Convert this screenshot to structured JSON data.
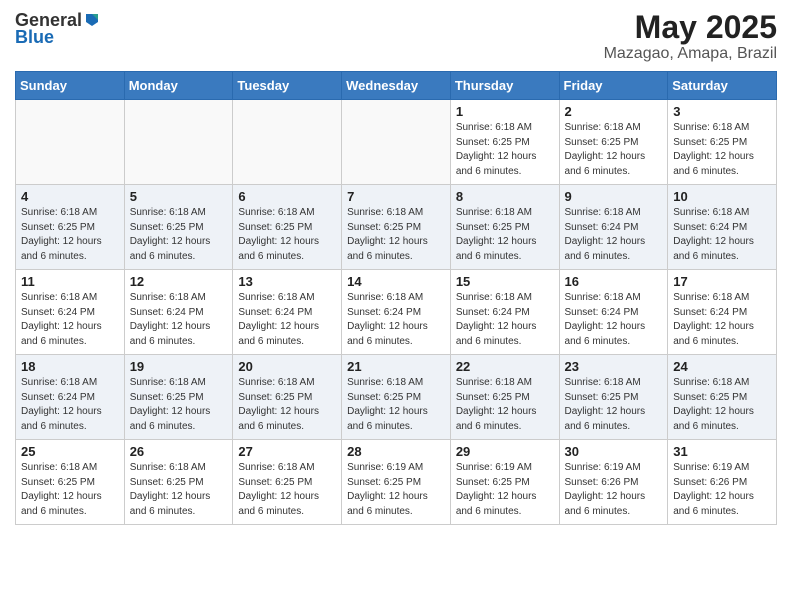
{
  "logo": {
    "general": "General",
    "blue": "Blue"
  },
  "title": "May 2025",
  "subtitle": "Mazagao, Amapa, Brazil",
  "weekdays": [
    "Sunday",
    "Monday",
    "Tuesday",
    "Wednesday",
    "Thursday",
    "Friday",
    "Saturday"
  ],
  "weeks": [
    [
      {
        "day": "",
        "info": ""
      },
      {
        "day": "",
        "info": ""
      },
      {
        "day": "",
        "info": ""
      },
      {
        "day": "",
        "info": ""
      },
      {
        "day": "1",
        "info": "Sunrise: 6:18 AM\nSunset: 6:25 PM\nDaylight: 12 hours and 6 minutes."
      },
      {
        "day": "2",
        "info": "Sunrise: 6:18 AM\nSunset: 6:25 PM\nDaylight: 12 hours and 6 minutes."
      },
      {
        "day": "3",
        "info": "Sunrise: 6:18 AM\nSunset: 6:25 PM\nDaylight: 12 hours and 6 minutes."
      }
    ],
    [
      {
        "day": "4",
        "info": "Sunrise: 6:18 AM\nSunset: 6:25 PM\nDaylight: 12 hours and 6 minutes."
      },
      {
        "day": "5",
        "info": "Sunrise: 6:18 AM\nSunset: 6:25 PM\nDaylight: 12 hours and 6 minutes."
      },
      {
        "day": "6",
        "info": "Sunrise: 6:18 AM\nSunset: 6:25 PM\nDaylight: 12 hours and 6 minutes."
      },
      {
        "day": "7",
        "info": "Sunrise: 6:18 AM\nSunset: 6:25 PM\nDaylight: 12 hours and 6 minutes."
      },
      {
        "day": "8",
        "info": "Sunrise: 6:18 AM\nSunset: 6:25 PM\nDaylight: 12 hours and 6 minutes."
      },
      {
        "day": "9",
        "info": "Sunrise: 6:18 AM\nSunset: 6:24 PM\nDaylight: 12 hours and 6 minutes."
      },
      {
        "day": "10",
        "info": "Sunrise: 6:18 AM\nSunset: 6:24 PM\nDaylight: 12 hours and 6 minutes."
      }
    ],
    [
      {
        "day": "11",
        "info": "Sunrise: 6:18 AM\nSunset: 6:24 PM\nDaylight: 12 hours and 6 minutes."
      },
      {
        "day": "12",
        "info": "Sunrise: 6:18 AM\nSunset: 6:24 PM\nDaylight: 12 hours and 6 minutes."
      },
      {
        "day": "13",
        "info": "Sunrise: 6:18 AM\nSunset: 6:24 PM\nDaylight: 12 hours and 6 minutes."
      },
      {
        "day": "14",
        "info": "Sunrise: 6:18 AM\nSunset: 6:24 PM\nDaylight: 12 hours and 6 minutes."
      },
      {
        "day": "15",
        "info": "Sunrise: 6:18 AM\nSunset: 6:24 PM\nDaylight: 12 hours and 6 minutes."
      },
      {
        "day": "16",
        "info": "Sunrise: 6:18 AM\nSunset: 6:24 PM\nDaylight: 12 hours and 6 minutes."
      },
      {
        "day": "17",
        "info": "Sunrise: 6:18 AM\nSunset: 6:24 PM\nDaylight: 12 hours and 6 minutes."
      }
    ],
    [
      {
        "day": "18",
        "info": "Sunrise: 6:18 AM\nSunset: 6:24 PM\nDaylight: 12 hours and 6 minutes."
      },
      {
        "day": "19",
        "info": "Sunrise: 6:18 AM\nSunset: 6:25 PM\nDaylight: 12 hours and 6 minutes."
      },
      {
        "day": "20",
        "info": "Sunrise: 6:18 AM\nSunset: 6:25 PM\nDaylight: 12 hours and 6 minutes."
      },
      {
        "day": "21",
        "info": "Sunrise: 6:18 AM\nSunset: 6:25 PM\nDaylight: 12 hours and 6 minutes."
      },
      {
        "day": "22",
        "info": "Sunrise: 6:18 AM\nSunset: 6:25 PM\nDaylight: 12 hours and 6 minutes."
      },
      {
        "day": "23",
        "info": "Sunrise: 6:18 AM\nSunset: 6:25 PM\nDaylight: 12 hours and 6 minutes."
      },
      {
        "day": "24",
        "info": "Sunrise: 6:18 AM\nSunset: 6:25 PM\nDaylight: 12 hours and 6 minutes."
      }
    ],
    [
      {
        "day": "25",
        "info": "Sunrise: 6:18 AM\nSunset: 6:25 PM\nDaylight: 12 hours and 6 minutes."
      },
      {
        "day": "26",
        "info": "Sunrise: 6:18 AM\nSunset: 6:25 PM\nDaylight: 12 hours and 6 minutes."
      },
      {
        "day": "27",
        "info": "Sunrise: 6:18 AM\nSunset: 6:25 PM\nDaylight: 12 hours and 6 minutes."
      },
      {
        "day": "28",
        "info": "Sunrise: 6:19 AM\nSunset: 6:25 PM\nDaylight: 12 hours and 6 minutes."
      },
      {
        "day": "29",
        "info": "Sunrise: 6:19 AM\nSunset: 6:25 PM\nDaylight: 12 hours and 6 minutes."
      },
      {
        "day": "30",
        "info": "Sunrise: 6:19 AM\nSunset: 6:26 PM\nDaylight: 12 hours and 6 minutes."
      },
      {
        "day": "31",
        "info": "Sunrise: 6:19 AM\nSunset: 6:26 PM\nDaylight: 12 hours and 6 minutes."
      }
    ]
  ]
}
